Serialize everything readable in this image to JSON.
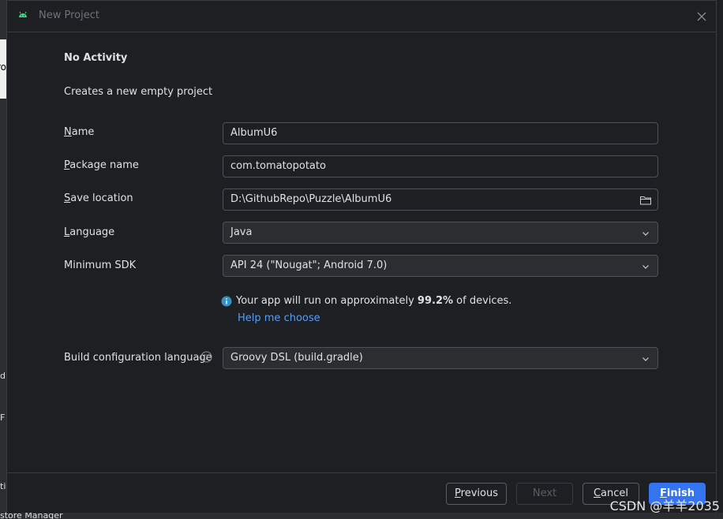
{
  "window": {
    "title": "New Project",
    "app_icon": "android-icon"
  },
  "template": {
    "heading": "No Activity",
    "description": "Creates a new empty project"
  },
  "form": {
    "name": {
      "label_ul": "N",
      "label_rest": "ame",
      "value": "AlbumU6"
    },
    "package": {
      "label_ul": "P",
      "label_rest": "ackage name",
      "value": "com.tomatopotato"
    },
    "save_location": {
      "label_ul": "S",
      "label_rest": "ave location",
      "value": "D:\\GithubRepo\\Puzzle\\AlbumU6",
      "icon": "folder-icon"
    },
    "language": {
      "label_ul": "L",
      "label_rest": "anguage",
      "value": "Java"
    },
    "min_sdk": {
      "label": "Minimum SDK",
      "value": "API 24 (\"Nougat\"; Android 7.0)"
    },
    "info": {
      "prefix": "Your app will run on approximately ",
      "percent": "99.2%",
      "suffix": " of devices.",
      "link": "Help me choose"
    },
    "build_lang": {
      "label": "Build configuration language",
      "value": "Groovy DSL (build.gradle)"
    }
  },
  "footer": {
    "previous": {
      "ul": "P",
      "rest": "revious"
    },
    "next": "Next",
    "cancel": {
      "ul": "C",
      "rest": "ancel"
    },
    "finish": {
      "ul": "F",
      "rest": "inish"
    }
  },
  "background": {
    "frag1": "ro",
    "frag2": "d",
    "frag3": "F",
    "frag4": "ti",
    "bottom": "store Manager"
  },
  "watermark": "CSDN @羊羊2035",
  "colors": {
    "accent": "#3574f0",
    "link": "#589df6",
    "info": "#3592c4",
    "android": "#3ddc84"
  }
}
